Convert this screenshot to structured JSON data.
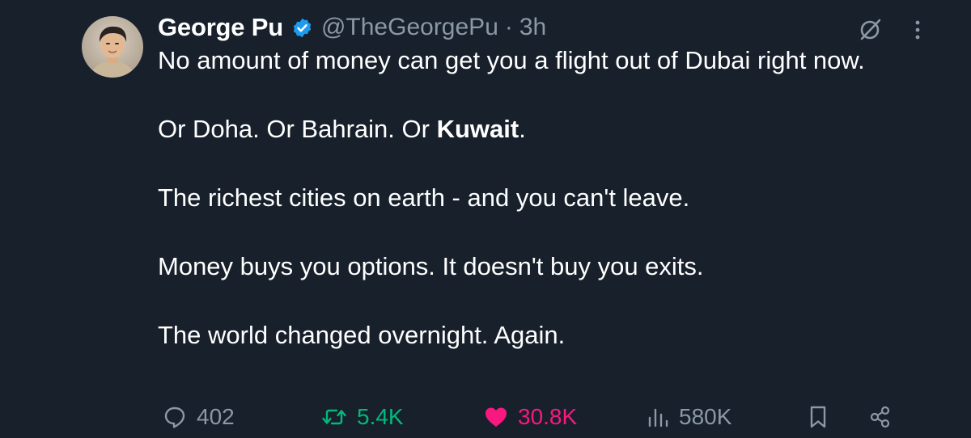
{
  "author": {
    "display_name": "George Pu",
    "handle": "@TheGeorgePu",
    "separator": "·",
    "time": "3h",
    "verified": true
  },
  "tweet": {
    "line1_text": "No amount of money can get you a flight out of Dubai right now.",
    "line2_prefix": "Or Doha. Or Bahrain. Or ",
    "line2_bold": "Kuwait",
    "line2_suffix": ".",
    "line3_text": "The richest cities on earth - and you can't leave.",
    "line4_text": "Money buys you options. It doesn't buy you exits.",
    "line5_text": "The world changed overnight. Again."
  },
  "actions": {
    "replies": "402",
    "reposts": "5.4K",
    "likes": "30.8K",
    "views": "580K"
  },
  "icons": {
    "reply": "reply-icon",
    "repost": "repost-icon",
    "like": "heart-icon",
    "views": "views-icon",
    "bookmark": "bookmark-icon",
    "share": "share-icon",
    "grok": "grok-icon",
    "more": "more-icon",
    "verified": "verified-badge-icon"
  },
  "colors": {
    "background": "#17202b",
    "text": "#ffffff",
    "muted": "#8b98a5",
    "verified": "#1d9bf0",
    "repost_active": "#00ba7c",
    "like_active": "#f91880"
  }
}
